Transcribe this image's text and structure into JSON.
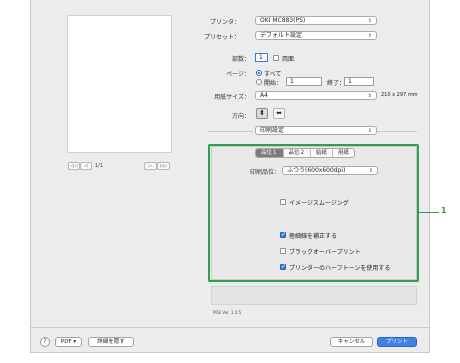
{
  "printer": {
    "label": "プリンタ：",
    "value": "OKI MC883(PS)"
  },
  "preset": {
    "label": "プリセット：",
    "value": "デフォルト設定"
  },
  "copies": {
    "label": "部数：",
    "value": "1",
    "duplex_label": "両面",
    "duplex_checked": false
  },
  "pages": {
    "label": "ページ：",
    "all_label": "すべて",
    "from_label": "開始：",
    "from_value": "1",
    "to_label": "終了：",
    "to_value": "1",
    "selected": "all"
  },
  "paper_size": {
    "label": "用紙サイズ：",
    "value": "A4",
    "dimensions": "210 x 297 mm"
  },
  "orientation": {
    "label": "方向：",
    "selected": "portrait"
  },
  "section_select": {
    "value": "印刷設定"
  },
  "preview_pager": {
    "first": "◁◁",
    "prev": "◁",
    "page_text": "1/1",
    "next": "▷",
    "last": "▷▷"
  },
  "tabs": [
    {
      "label": "品位１",
      "active": true
    },
    {
      "label": "品位２",
      "active": false
    },
    {
      "label": "給紙",
      "active": false
    },
    {
      "label": "用紙",
      "active": false
    }
  ],
  "quality": {
    "label": "印刷品位：",
    "value": "ふつう(600x600dpi)"
  },
  "options": {
    "image_smoothing": {
      "label": "イメージスムージング",
      "checked": false
    },
    "fine_line": {
      "label": "極細線を補正する",
      "checked": true
    },
    "black_overprint": {
      "label": "ブラックオーバープリント",
      "checked": false
    },
    "printer_halftone": {
      "label": "プリンターのハーフトーンを使用する",
      "checked": true
    }
  },
  "ppd_version": "PDE Ver. 1.0.5",
  "bottom": {
    "help": "?",
    "pdf": "PDF",
    "details": "詳細を隠す",
    "cancel": "キャンセル",
    "print": "プリント"
  },
  "callout": "1",
  "colors": {
    "highlight": "#2f9e4f",
    "accent": "#3b7be4"
  }
}
